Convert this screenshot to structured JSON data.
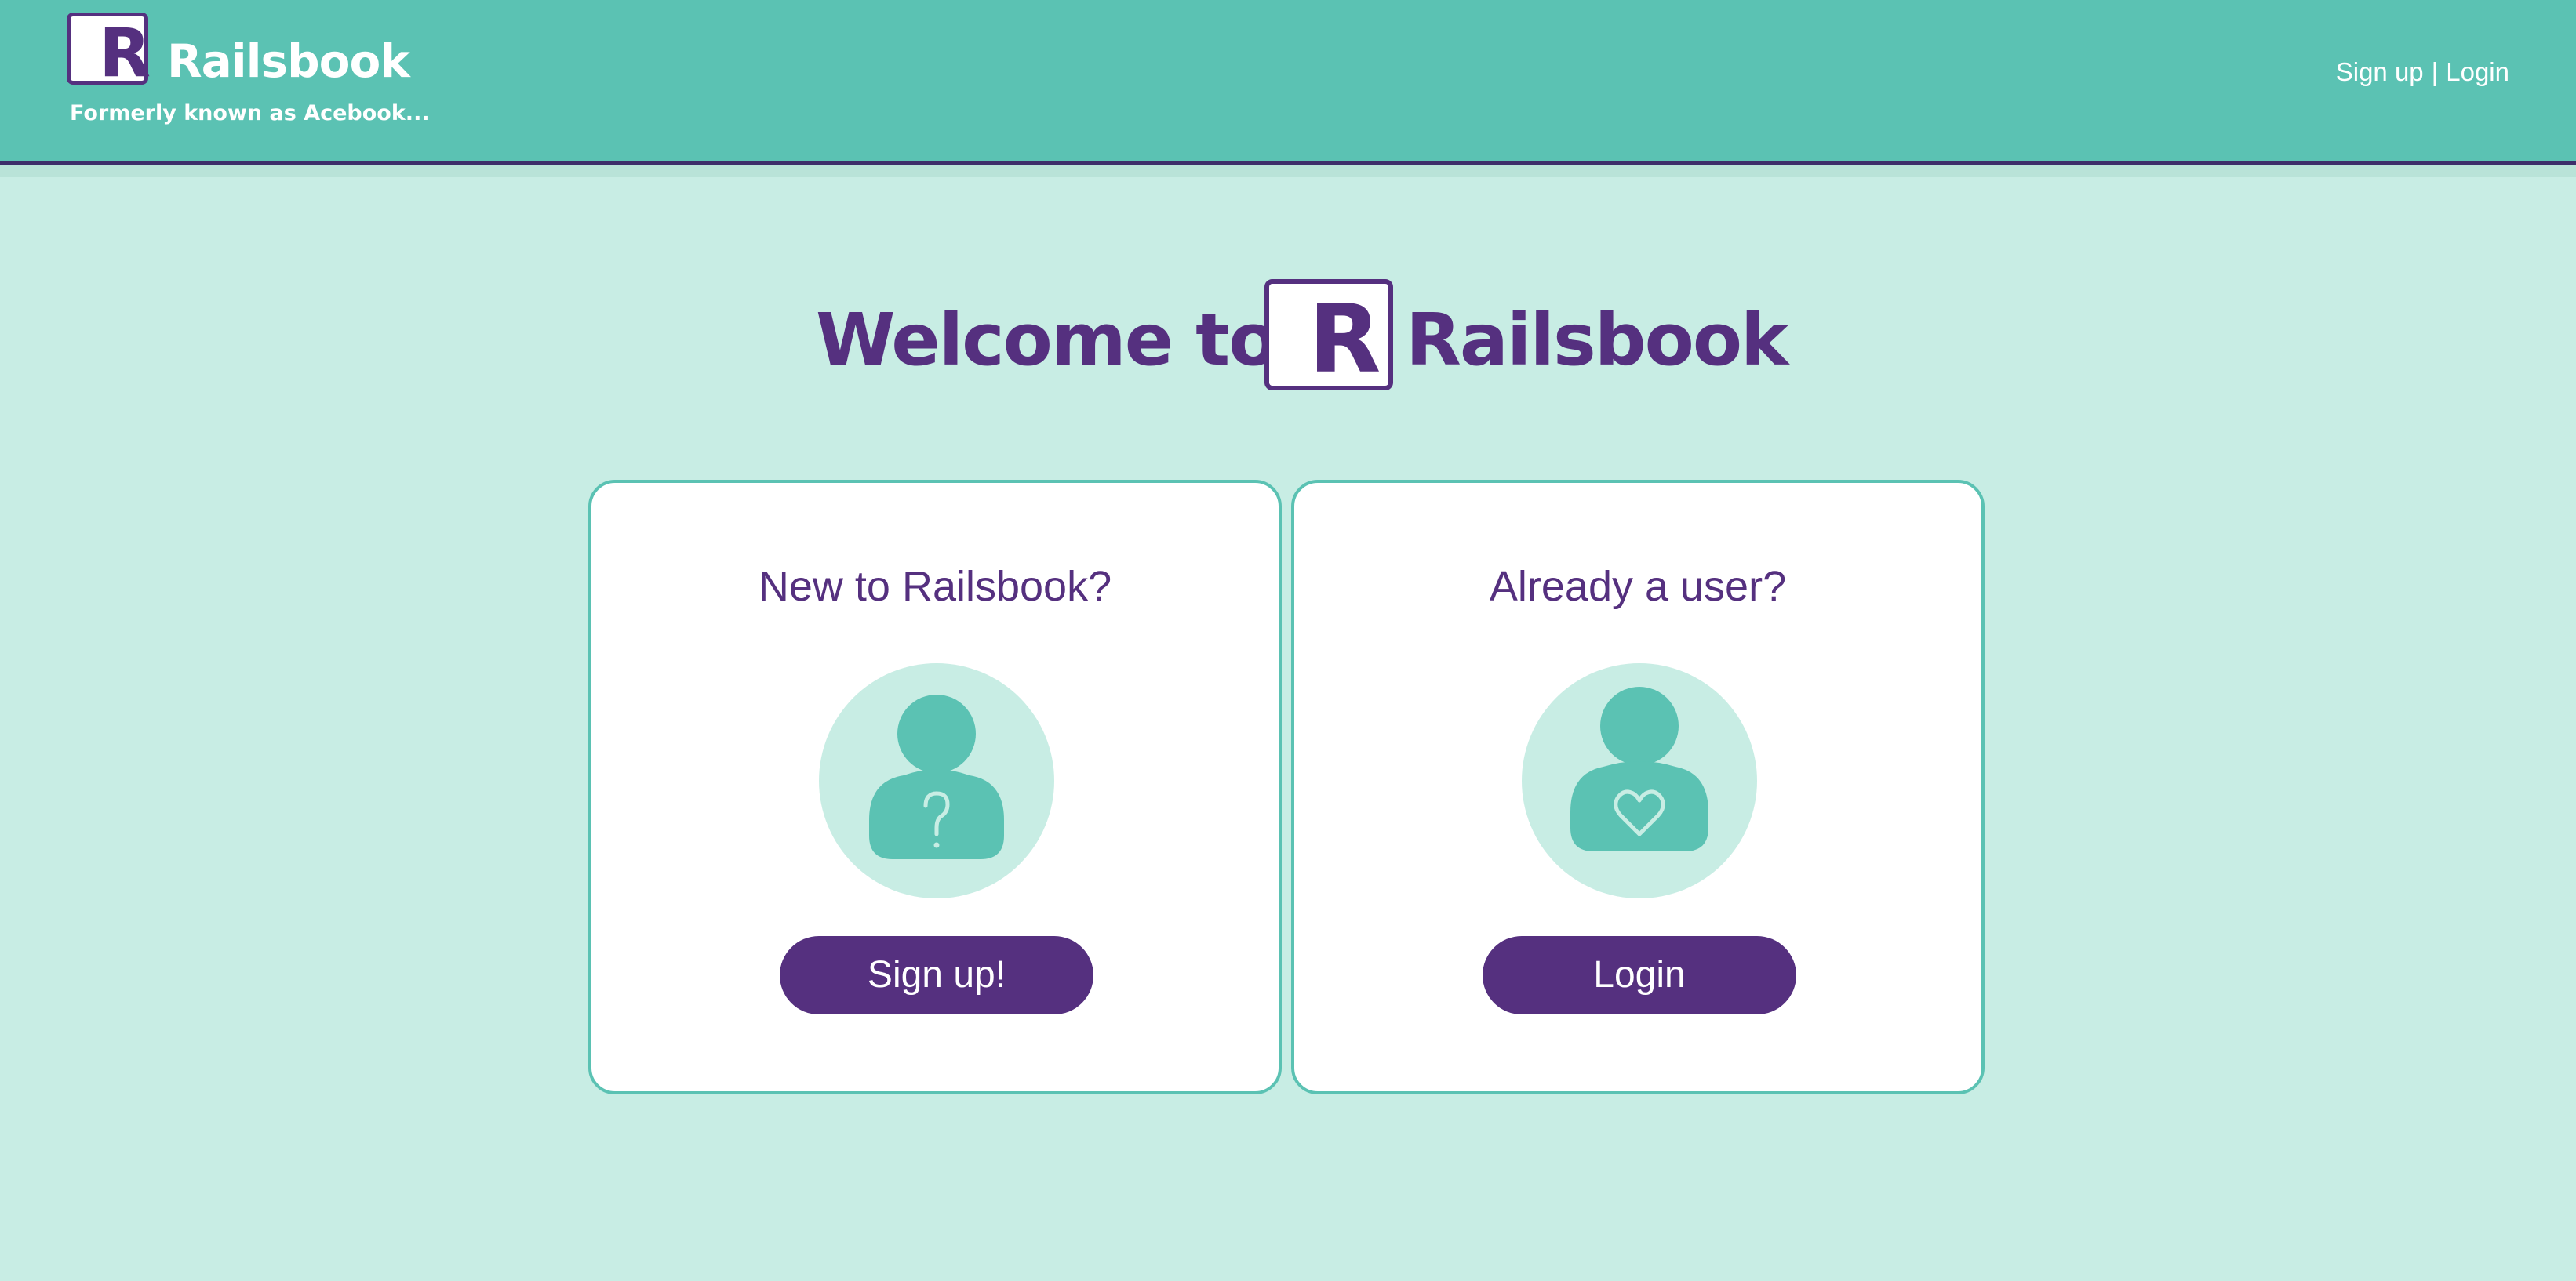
{
  "header": {
    "brand_logo_letter": "R",
    "brand_name": "Railsbook",
    "tagline": "Formerly known as Acebook...",
    "nav_signup": "Sign up",
    "nav_separator": "|",
    "nav_login": "Login"
  },
  "hero": {
    "welcome_prefix": "Welcome to",
    "logo_letter": "R",
    "welcome_name": "Railsbook"
  },
  "cards": [
    {
      "title": "New to Railsbook?",
      "icon": "user-question-icon",
      "button_label": "Sign up!"
    },
    {
      "title": "Already a user?",
      "icon": "user-heart-icon",
      "button_label": "Login"
    }
  ],
  "colors": {
    "header_bg": "#5bc2b3",
    "page_bg": "#c8ede4",
    "brand_purple": "#55307f",
    "icon_circle": "#c8ede4",
    "icon_figure": "#5bc2b3"
  }
}
